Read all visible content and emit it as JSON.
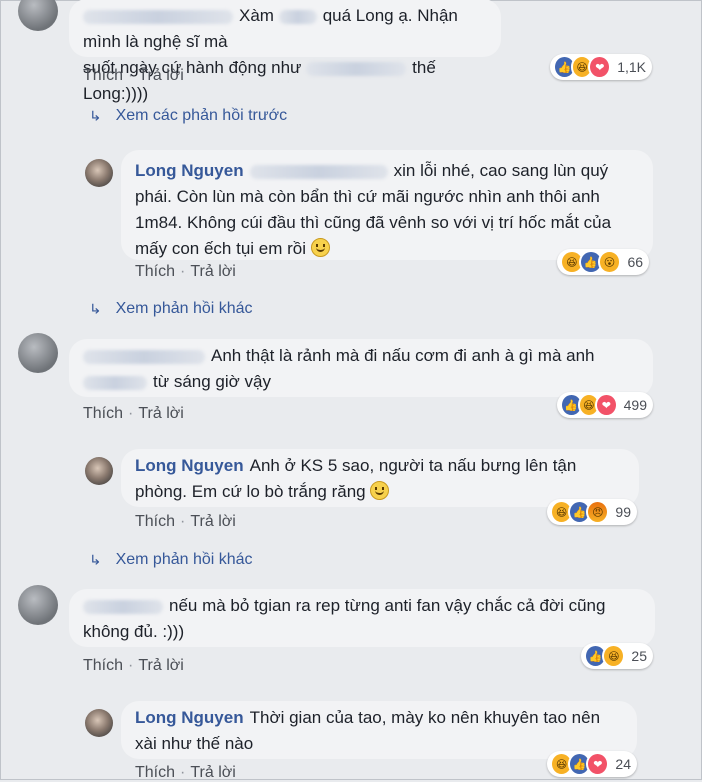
{
  "actions": {
    "like": "Thích",
    "reply": "Trả lời",
    "sep": "·"
  },
  "icons": {
    "reply_arrow": "reply-arrow-icon",
    "smile": "smile-emoji-icon"
  },
  "reaction_colors": {
    "like": "#4267b2",
    "haha": "#f7b125",
    "love": "#f25268"
  },
  "thread": {
    "c1": {
      "text_a": "Xàm",
      "text_b": "quá Long ạ. Nhận mình là nghệ sĩ mà",
      "text_c": "suốt ngày cứ hành động như",
      "text_d": "thế Long:))))",
      "reactions": [
        "like",
        "haha",
        "love"
      ],
      "count": "1,1K"
    },
    "prev_replies": "Xem các phản hồi trước",
    "r1": {
      "author": "Long Nguyen",
      "text_a": "xin lỗi nhé, cao sang lùn quý",
      "text_b": "phái. Còn lùn mà còn bẩn thì cứ mãi ngước nhìn anh thôi anh",
      "text_c": "1m84. Không cúi đầu thì cũng đã vênh so với vị trí hốc mắt của",
      "text_d": "mấy con ếch tụi em rồi",
      "reactions": [
        "haha",
        "like",
        "wow"
      ],
      "count": "66"
    },
    "more1": "Xem phản hồi khác",
    "c2": {
      "text_a": "Anh thật là rảnh mà đi nấu cơm đi anh à gì mà anh",
      "text_b": "từ sáng giờ vậy",
      "reactions": [
        "like",
        "haha",
        "love"
      ],
      "count": "499"
    },
    "r2": {
      "author": "Long Nguyen",
      "text_a": "Anh ở KS 5 sao, người ta nấu bưng lên tận",
      "text_b": "phòng. Em cứ lo bò trắng răng",
      "reactions": [
        "haha",
        "like",
        "angry"
      ],
      "count": "99"
    },
    "more2": "Xem phản hồi khác",
    "c3": {
      "text_a": "nếu mà bỏ tgian ra rep từng anti fan vậy chắc cả đời cũng",
      "text_b": "không đủ. :)))",
      "reactions": [
        "like",
        "haha"
      ],
      "count": "25"
    },
    "r3": {
      "author": "Long Nguyen",
      "text_a": "Thời gian của tao, mày ko nên khuyên tao nên",
      "text_b": "xài như thế nào",
      "reactions": [
        "haha",
        "like",
        "love"
      ],
      "count": "24"
    }
  }
}
